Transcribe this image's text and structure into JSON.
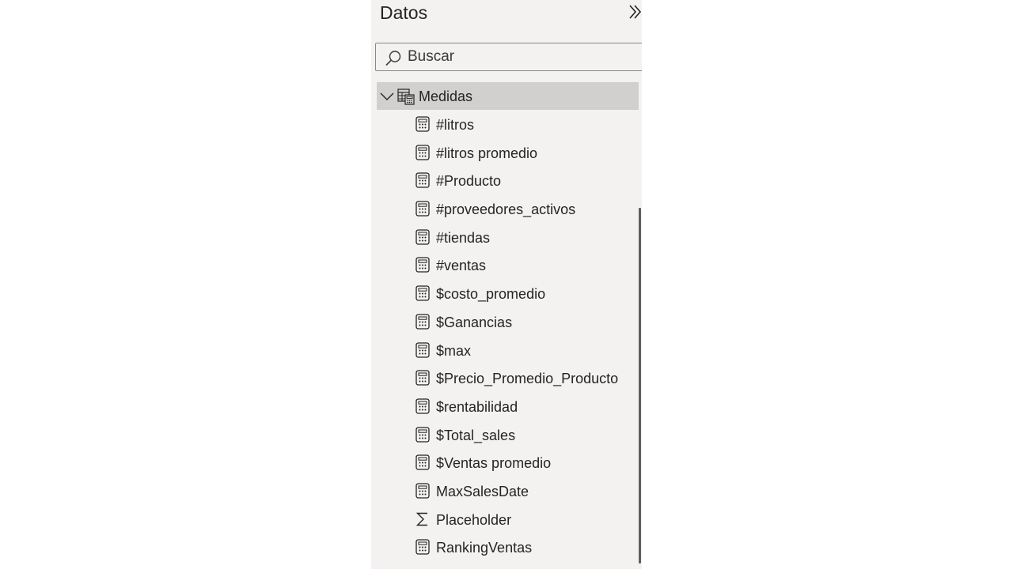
{
  "pane": {
    "title": "Datos",
    "collapse_icon": "double-chevron-right-icon"
  },
  "search": {
    "placeholder": "Buscar",
    "value": ""
  },
  "group": {
    "label": "Medidas",
    "expanded": true,
    "icon": "measure-table-icon"
  },
  "items": [
    {
      "label": "#litros",
      "icon": "calculator-icon"
    },
    {
      "label": "#litros promedio",
      "icon": "calculator-icon"
    },
    {
      "label": "#Producto",
      "icon": "calculator-icon"
    },
    {
      "label": "#proveedores_activos",
      "icon": "calculator-icon"
    },
    {
      "label": "#tiendas",
      "icon": "calculator-icon"
    },
    {
      "label": "#ventas",
      "icon": "calculator-icon"
    },
    {
      "label": "$costo_promedio",
      "icon": "calculator-icon"
    },
    {
      "label": "$Ganancias",
      "icon": "calculator-icon"
    },
    {
      "label": "$max",
      "icon": "calculator-icon"
    },
    {
      "label": "$Precio_Promedio_Producto",
      "icon": "calculator-icon"
    },
    {
      "label": "$rentabilidad",
      "icon": "calculator-icon"
    },
    {
      "label": "$Total_sales",
      "icon": "calculator-icon"
    },
    {
      "label": "$Ventas promedio",
      "icon": "calculator-icon"
    },
    {
      "label": "MaxSalesDate",
      "icon": "calculator-icon"
    },
    {
      "label": "Placeholder",
      "icon": "sigma-icon"
    },
    {
      "label": "RankingVentas",
      "icon": "calculator-icon"
    }
  ],
  "colors": {
    "pane_background": "#f3f2f1",
    "selected_row": "#d2d0ce",
    "text": "#252423"
  }
}
